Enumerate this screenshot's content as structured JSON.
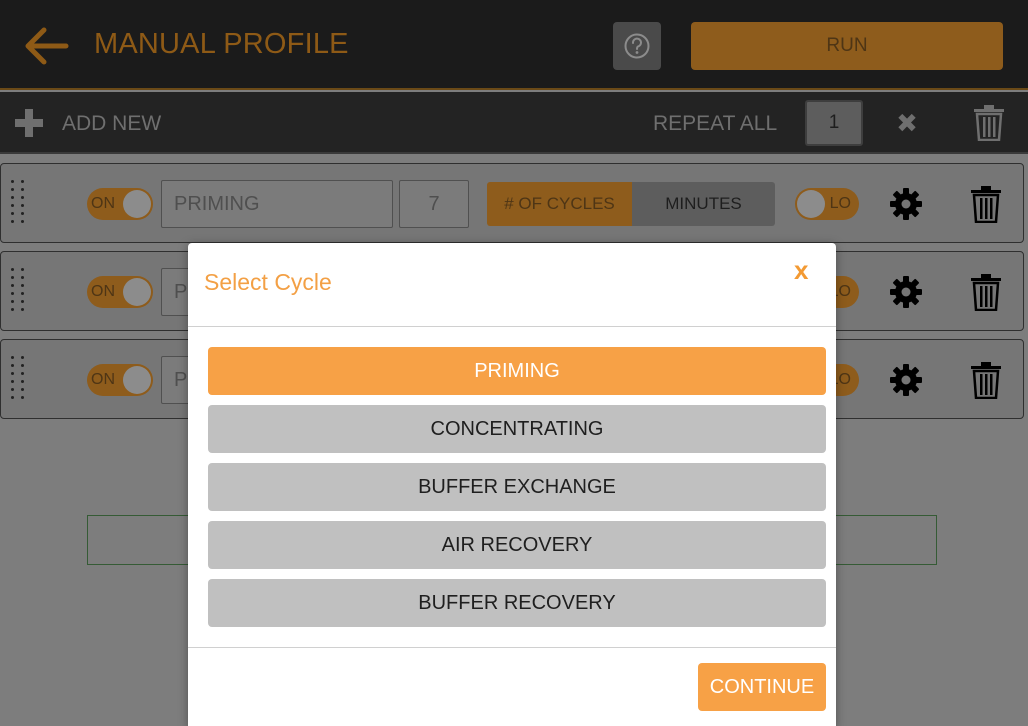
{
  "header": {
    "title": "MANUAL PROFILE",
    "run_label": "RUN",
    "accent_color": "#8e5c1c"
  },
  "toolbar": {
    "add_label": "ADD NEW",
    "repeat_label": "REPEAT ALL",
    "repeat_value": "1"
  },
  "rows": [
    {
      "toggle_label": "ON",
      "name": "PRIMING",
      "count": "7",
      "mode_cycles": "# OF CYCLES",
      "mode_minutes": "MINUTES",
      "lo_label": "LO"
    },
    {
      "toggle_label": "ON",
      "name_partial": "P",
      "lo_label": "LO"
    },
    {
      "toggle_label": "ON",
      "name_partial": "P",
      "lo_label": "LO"
    }
  ],
  "modal": {
    "title": "Select Cycle",
    "close_label": "x",
    "options": [
      "PRIMING",
      "CONCENTRATING",
      "BUFFER EXCHANGE",
      "AIR RECOVERY",
      "BUFFER RECOVERY"
    ],
    "selected_option": "PRIMING",
    "continue_label": "CONTINUE",
    "accent_color": "#f7a146"
  }
}
